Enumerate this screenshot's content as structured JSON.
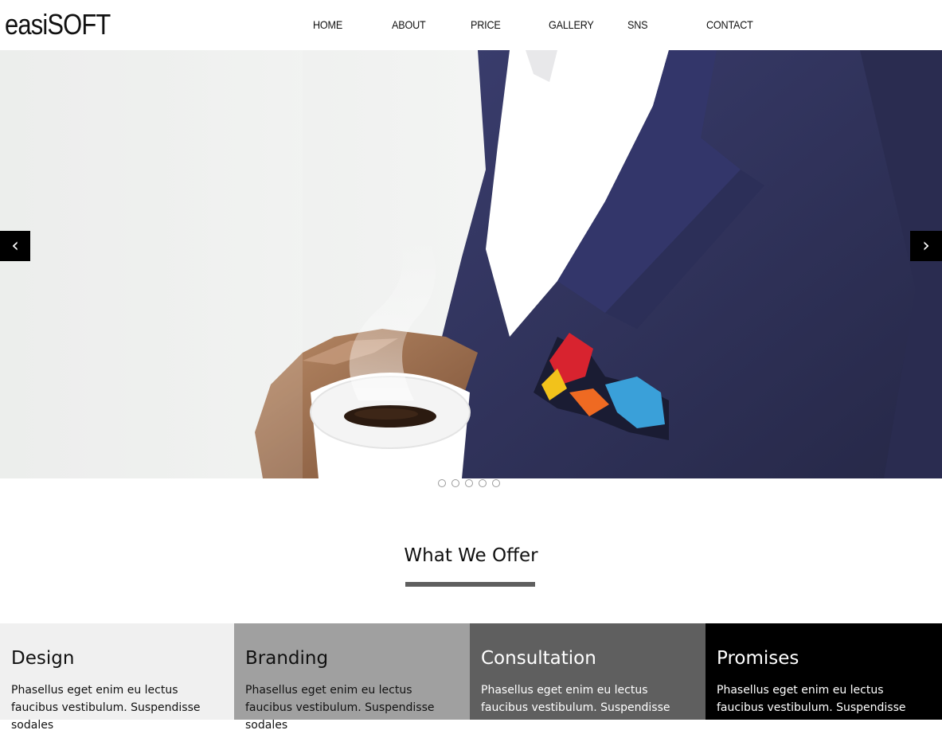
{
  "brand": {
    "logo": "easiSOFT"
  },
  "nav": {
    "items": [
      "HOME",
      "ABOUT",
      "PRICE",
      "GALLERY",
      "SNS",
      "CONTACT"
    ]
  },
  "hero": {
    "prev_label": "‹",
    "next_label": "›",
    "slide_count": 5,
    "active_slide": 1
  },
  "section": {
    "title": "What We Offer"
  },
  "offers": [
    {
      "title": "Design",
      "text": "Phasellus eget enim eu lectus faucibus vestibulum. Suspendisse sodales",
      "bg": "#f0f0f0",
      "fg": "#111111"
    },
    {
      "title": "Branding",
      "text": "Phasellus eget enim eu lectus faucibus vestibulum. Suspendisse sodales",
      "bg": "#a0a0a0",
      "fg": "#111111"
    },
    {
      "title": "Consultation",
      "text": "Phasellus eget enim eu lectus faucibus vestibulum. Suspendisse sodales",
      "bg": "#5f5f5f",
      "fg": "#ffffff"
    },
    {
      "title": "Promises",
      "text": "Phasellus eget enim eu lectus faucibus vestibulum. Suspendisse sodales",
      "bg": "#000000",
      "fg": "#ffffff"
    }
  ],
  "colors": {
    "suit": "#2d2f5a",
    "shirt": "#ffffff",
    "accent_bar": "#5f5f5f"
  }
}
